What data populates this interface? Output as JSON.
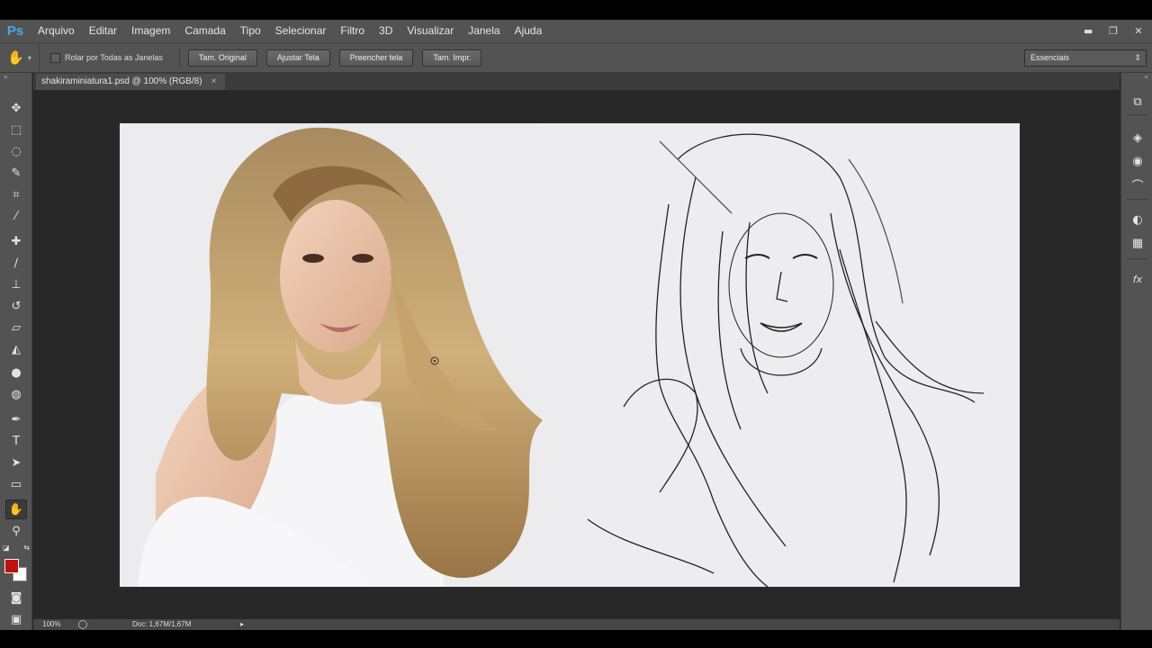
{
  "app": {
    "logo": "Ps"
  },
  "menu": [
    "Arquivo",
    "Editar",
    "Imagem",
    "Camada",
    "Tipo",
    "Selecionar",
    "Filtro",
    "3D",
    "Visualizar",
    "Janela",
    "Ajuda"
  ],
  "window_controls": {
    "minimize": "▬",
    "restore": "❐",
    "close": "✕"
  },
  "options": {
    "tool_icon": "hand-icon",
    "scroll_all_label": "Rolar por Todas as Janelas",
    "buttons": [
      "Tam. Original",
      "Ajustar Tela",
      "Preencher tela",
      "Tam. Impr."
    ],
    "workspace": "Essenciais"
  },
  "document": {
    "tab_title": "shakiraminiatura1.psd @ 100% (RGB/8)",
    "close_glyph": "×"
  },
  "status": {
    "zoom": "100%",
    "doc_info": "Doc: 1,67M/1,67M"
  },
  "colors": {
    "foreground": "#c1110f",
    "background": "#ffffff"
  },
  "tools": [
    "move-icon",
    "marquee-icon",
    "lasso-icon",
    "quick-selection-icon",
    "crop-icon",
    "eyedropper-icon",
    "healing-brush-icon",
    "brush-icon",
    "clone-stamp-icon",
    "history-brush-icon",
    "eraser-icon",
    "paint-bucket-icon",
    "blur-icon",
    "dodge-icon",
    "pen-icon",
    "type-icon",
    "path-selection-icon",
    "rectangle-icon",
    "hand-icon",
    "zoom-icon"
  ],
  "dock_icons": [
    "history-panel-icon",
    "layers-panel-icon",
    "channels-panel-icon",
    "paths-panel-icon",
    "adjustments-panel-icon",
    "swatches-panel-icon",
    "styles-panel-icon"
  ]
}
